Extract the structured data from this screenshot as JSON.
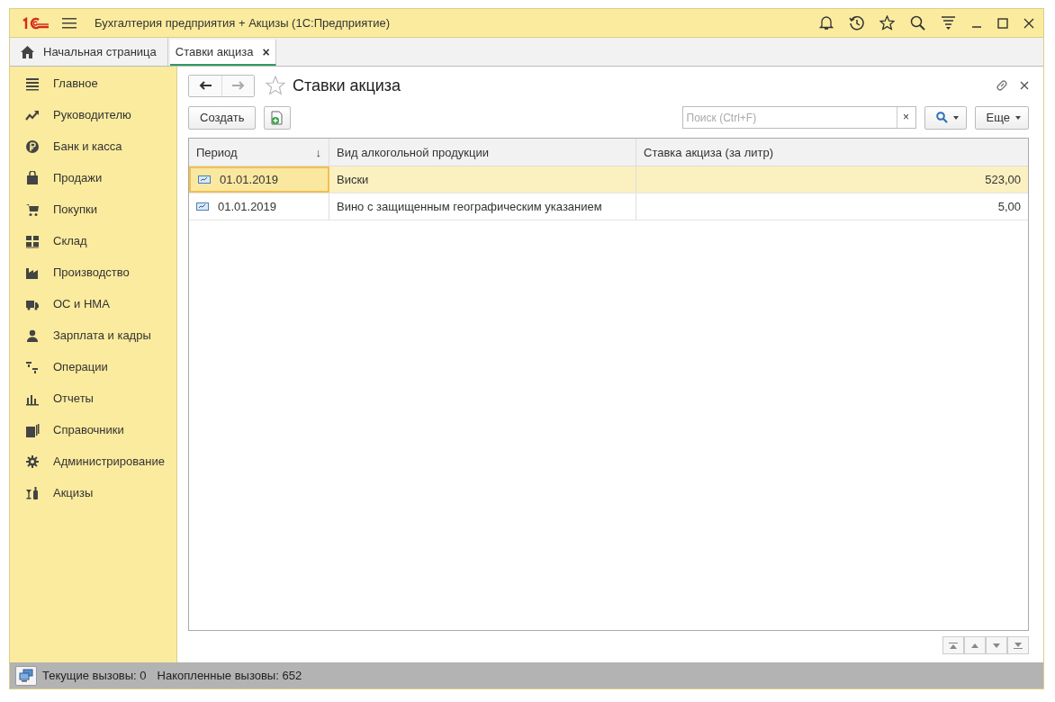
{
  "window": {
    "title": "Бухгалтерия предприятия + Акцизы  (1С:Предприятие)"
  },
  "tabs": [
    {
      "label": "Начальная страница",
      "selected": false
    },
    {
      "label": "Ставки акциза",
      "selected": true,
      "close": "×"
    }
  ],
  "sidebar": {
    "items": [
      {
        "label": "Главное"
      },
      {
        "label": "Руководителю"
      },
      {
        "label": "Банк и касса"
      },
      {
        "label": "Продажи"
      },
      {
        "label": "Покупки"
      },
      {
        "label": "Склад"
      },
      {
        "label": "Производство"
      },
      {
        "label": "ОС и НМА"
      },
      {
        "label": "Зарплата и кадры"
      },
      {
        "label": "Операции"
      },
      {
        "label": "Отчеты"
      },
      {
        "label": "Справочники"
      },
      {
        "label": "Администрирование"
      },
      {
        "label": "Акцизы"
      }
    ]
  },
  "form": {
    "title": "Ставки акциза",
    "create_button": "Создать",
    "search": {
      "placeholder": "Поиск (Ctrl+F)",
      "clear": "×"
    },
    "more_button": "Еще"
  },
  "table": {
    "columns": [
      {
        "label": "Период",
        "sort": "↓"
      },
      {
        "label": "Вид алкогольной продукции"
      },
      {
        "label": "Ставка акциза (за литр)"
      }
    ],
    "rows": [
      {
        "period": "01.01.2019",
        "product": "Виски",
        "rate": "523,00",
        "selected": true
      },
      {
        "period": "01.01.2019",
        "product": "Вино с защищенным географическим указанием",
        "rate": "5,00",
        "selected": false
      }
    ]
  },
  "status_bar": {
    "current": "Текущие вызовы: 0",
    "accumulated": "Накопленные вызовы: 652"
  }
}
